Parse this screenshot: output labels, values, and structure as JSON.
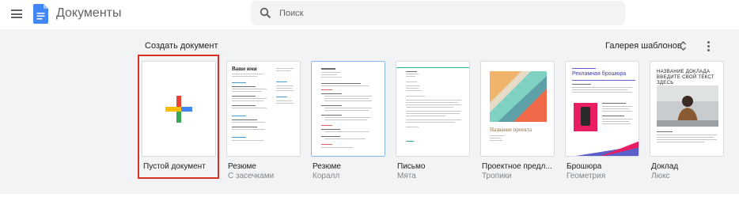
{
  "header": {
    "app_title": "Документы",
    "search_placeholder": "Поиск",
    "menu_icon": "hamburger-menu-icon",
    "logo_icon": "google-docs-logo-icon",
    "logo_color": "#4285f4"
  },
  "templates": {
    "section_title": "Создать документ",
    "gallery_label": "Галерея шаблонов",
    "blank": {
      "name": "Пустой документ",
      "icon": "plus-multicolor-icon"
    },
    "items": [
      {
        "name": "Резюме",
        "sub": "С засечками",
        "thumb_title": "Ваше имя"
      },
      {
        "name": "Резюме",
        "sub": "Коралл"
      },
      {
        "name": "Письмо",
        "sub": "Мята"
      },
      {
        "name": "Проектное предл...",
        "sub": "Тропики",
        "thumb_title": "Название проекта"
      },
      {
        "name": "Брошюра",
        "sub": "Геометрия",
        "thumb_title": "Рекламная брошюра"
      },
      {
        "name": "Доклад",
        "sub": "Люкс",
        "thumb_title": "НАЗВАНИЕ ДОКЛАДА ВВЕДИТЕ СВОЙ ТЕКСТ ЗДЕСЬ"
      }
    ]
  },
  "colors": {
    "highlight_border": "#d93025",
    "panel_bg": "#f1f3f4",
    "plus_blue": "#4285f4",
    "plus_red": "#ea4335",
    "plus_yellow": "#fbbc04",
    "plus_green": "#34a853"
  }
}
